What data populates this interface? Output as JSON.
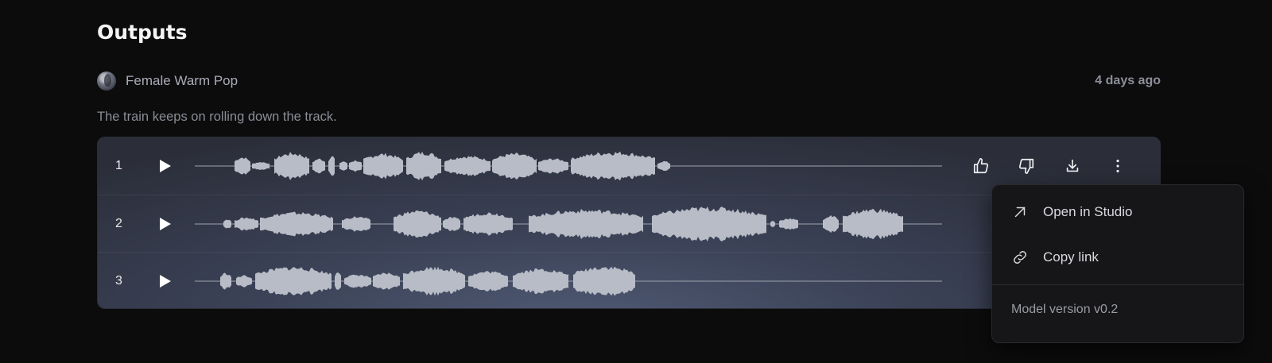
{
  "section": {
    "title": "Outputs"
  },
  "voice": {
    "name": "Female Warm Pop",
    "time_ago": "4 days ago"
  },
  "prompt": {
    "text": "The train keeps on rolling down the track."
  },
  "tracks": [
    {
      "number": "1"
    },
    {
      "number": "2"
    },
    {
      "number": "3"
    }
  ],
  "actions": {
    "like": "thumbs-up-icon",
    "dislike": "thumbs-down-icon",
    "download": "download-icon",
    "more": "more-vertical-icon"
  },
  "menu": {
    "open_studio": "Open in Studio",
    "copy_link": "Copy link",
    "model_version": "Model version v0.2"
  },
  "colors": {
    "background": "#0c0c0d",
    "card": "#3b4257",
    "waveform": "#b8bcc6",
    "menu": "#161618"
  }
}
